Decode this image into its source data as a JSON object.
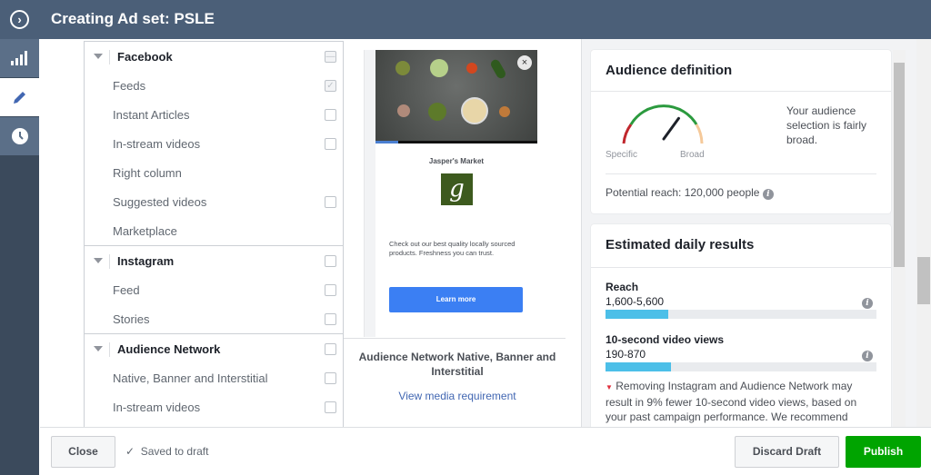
{
  "header": {
    "title": "Creating Ad set: PSLE",
    "toggle_icon": "chevron-right-circle-icon"
  },
  "rail": [
    {
      "icon": "chart-bars-icon"
    },
    {
      "icon": "pencil-icon",
      "active": true
    },
    {
      "icon": "clock-icon"
    }
  ],
  "placements": {
    "groups": [
      {
        "label": "Facebook",
        "state": "indeterminate",
        "items": [
          {
            "label": "Feeds",
            "checkbox": "checked-disabled"
          },
          {
            "label": "Instant Articles",
            "checkbox": "unchecked"
          },
          {
            "label": "In-stream videos",
            "checkbox": "unchecked"
          },
          {
            "label": "Right column",
            "checkbox": "none"
          },
          {
            "label": "Suggested videos",
            "checkbox": "unchecked"
          },
          {
            "label": "Marketplace",
            "checkbox": "none"
          }
        ]
      },
      {
        "label": "Instagram",
        "state": "unchecked",
        "items": [
          {
            "label": "Feed",
            "checkbox": "unchecked"
          },
          {
            "label": "Stories",
            "checkbox": "unchecked"
          }
        ]
      },
      {
        "label": "Audience Network",
        "state": "unchecked",
        "items": [
          {
            "label": "Native, Banner and Interstitial",
            "checkbox": "unchecked"
          },
          {
            "label": "In-stream videos",
            "checkbox": "unchecked"
          }
        ]
      }
    ]
  },
  "preview": {
    "brand": "Jasper's Market",
    "logo_letter": "g",
    "ad_text": "Check out our best quality locally sourced products. Freshness you can trust.",
    "cta": "Learn more",
    "placement_title": "Audience Network Native, Banner and Interstitial",
    "link": "View media requirement",
    "video_progress": 0.14
  },
  "audience": {
    "title": "Audience definition",
    "gauge_left": "Specific",
    "gauge_right": "Broad",
    "gauge_level": 0.7,
    "description": "Your audience selection is fairly broad.",
    "potential_reach": "Potential reach: 120,000 people"
  },
  "estimates": {
    "title": "Estimated daily results",
    "metrics": [
      {
        "name": "Reach",
        "value": "1,600-5,600",
        "fill": 0.23
      },
      {
        "name": "10-second video views",
        "value": "190-870",
        "fill": 0.24
      }
    ],
    "notice": "Removing Instagram and Audience Network may result in 9% fewer 10-second video views, based on your past campaign performance. We recommend"
  },
  "footer": {
    "close": "Close",
    "saved": "Saved to draft",
    "discard": "Discard Draft",
    "publish": "Publish"
  },
  "colors": {
    "header": "#4b5f78",
    "publish": "#00a400",
    "cta": "#3b7ff3",
    "bar": "#4cbfe8"
  }
}
